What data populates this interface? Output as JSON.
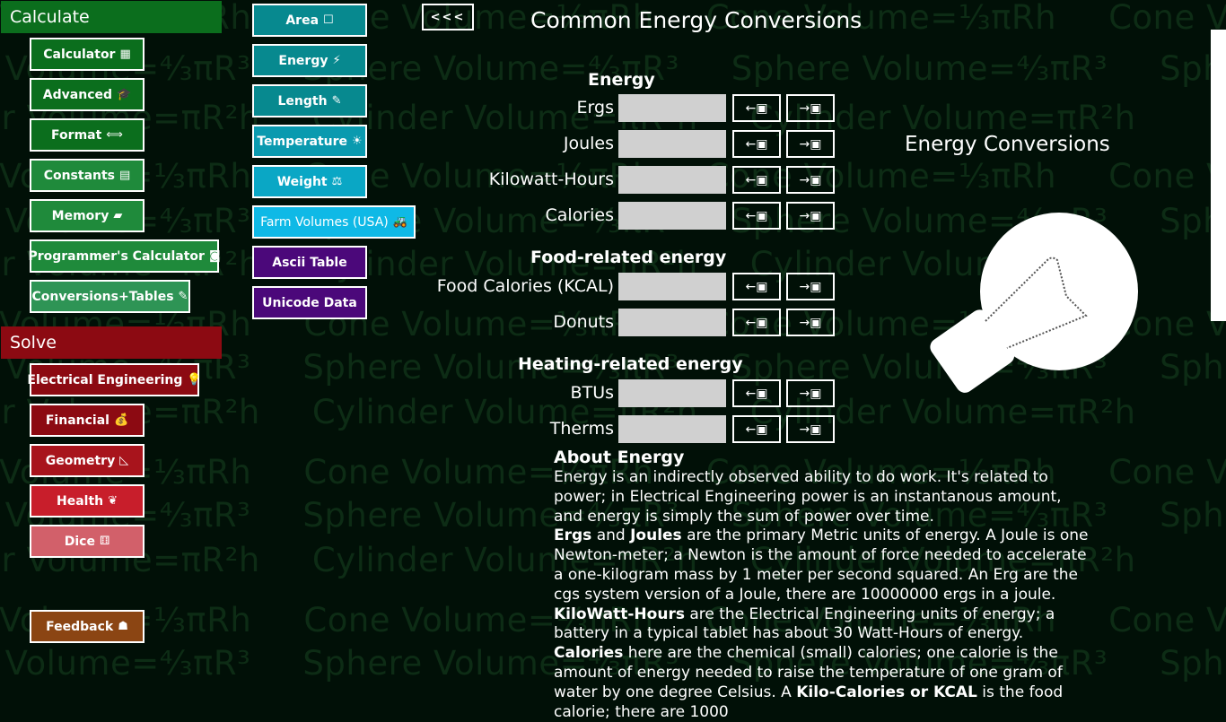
{
  "watermark": {
    "cone": "Cone Volume=⅓πRh",
    "sphere": "Sphere Volume=⁴⁄₃πR³",
    "cylinder": "Cylinder Volume=πR²h"
  },
  "calculate": {
    "heading": "Calculate",
    "items": [
      {
        "label": "Calculator",
        "icon": "▦"
      },
      {
        "label": "Advanced",
        "icon": "🎓"
      },
      {
        "label": "Format",
        "icon": "⟺"
      },
      {
        "label": "Constants",
        "icon": "▤"
      },
      {
        "label": "Memory",
        "icon": "▰"
      },
      {
        "label": "Programmer's Calculator",
        "icon": "◙"
      },
      {
        "label": "Conversions+Tables",
        "icon": "✎"
      }
    ]
  },
  "solve": {
    "heading": "Solve",
    "items": [
      {
        "label": "Electrical Engineering",
        "icon": "💡"
      },
      {
        "label": "Financial",
        "icon": "💰"
      },
      {
        "label": "Geometry",
        "icon": "◺"
      },
      {
        "label": "Health",
        "icon": "❦"
      },
      {
        "label": "Dice",
        "icon": "⚅"
      }
    ]
  },
  "feedback": {
    "label": "Feedback",
    "icon": "☗"
  },
  "conversions": {
    "items": [
      {
        "label": "Area",
        "icon": "☐"
      },
      {
        "label": "Energy",
        "icon": "⚡"
      },
      {
        "label": "Length",
        "icon": "✎"
      },
      {
        "label": "Temperature",
        "icon": "☀"
      },
      {
        "label": "Weight",
        "icon": "⚖"
      },
      {
        "label": "Farm Volumes (USA)",
        "icon": "🚜"
      },
      {
        "label": "Ascii Table",
        "icon": ""
      },
      {
        "label": "Unicode Data",
        "icon": ""
      }
    ]
  },
  "back_label": "<<<",
  "page_title": "Common Energy Conversions",
  "side_title": "Energy Conversions",
  "arrow_left": "←▣",
  "arrow_right": "→▣",
  "groups": {
    "energy": {
      "title": "Energy",
      "rows": [
        "Ergs",
        "Joules",
        "Kilowatt-Hours",
        "Calories"
      ]
    },
    "food": {
      "title": "Food-related energy",
      "rows": [
        "Food Calories (KCAL)",
        "Donuts"
      ]
    },
    "heating": {
      "title": "Heating-related energy",
      "rows": [
        "BTUs",
        "Therms"
      ]
    }
  },
  "about": {
    "heading": "About Energy",
    "p1": "Energy is an indirectly observed ability to do work. It's related to power; in Electrical Engineering power is an instantanous amount, and energy is simply the sum of power over time.",
    "p2_b1": "Ergs",
    "p2_and": " and ",
    "p2_b2": "Joules",
    "p2_rest": " are the primary Metric units of energy. A Joule is one Newton-meter; a Newton is the amount of force needed to accelerate a one-kilogram mass by 1 meter per second squared. An Erg are the cgs system version of a Joule, there are 10000000 ergs in a joule.",
    "p3_b": "KiloWatt-Hours",
    "p3_rest": " are the Electrical Engineering units of energy; a battery in a typical tablet has about 30 Watt-Hours of energy.",
    "p4_b": "Calories",
    "p4_rest": " here are the chemical (small) calories; one calorie is the amount of energy needed to raise the temperature of one gram of water by one degree Celsius. A ",
    "p4_b2": "Kilo-Calories or KCAL",
    "p4_rest2": " is the food calorie; there are 1000"
  }
}
